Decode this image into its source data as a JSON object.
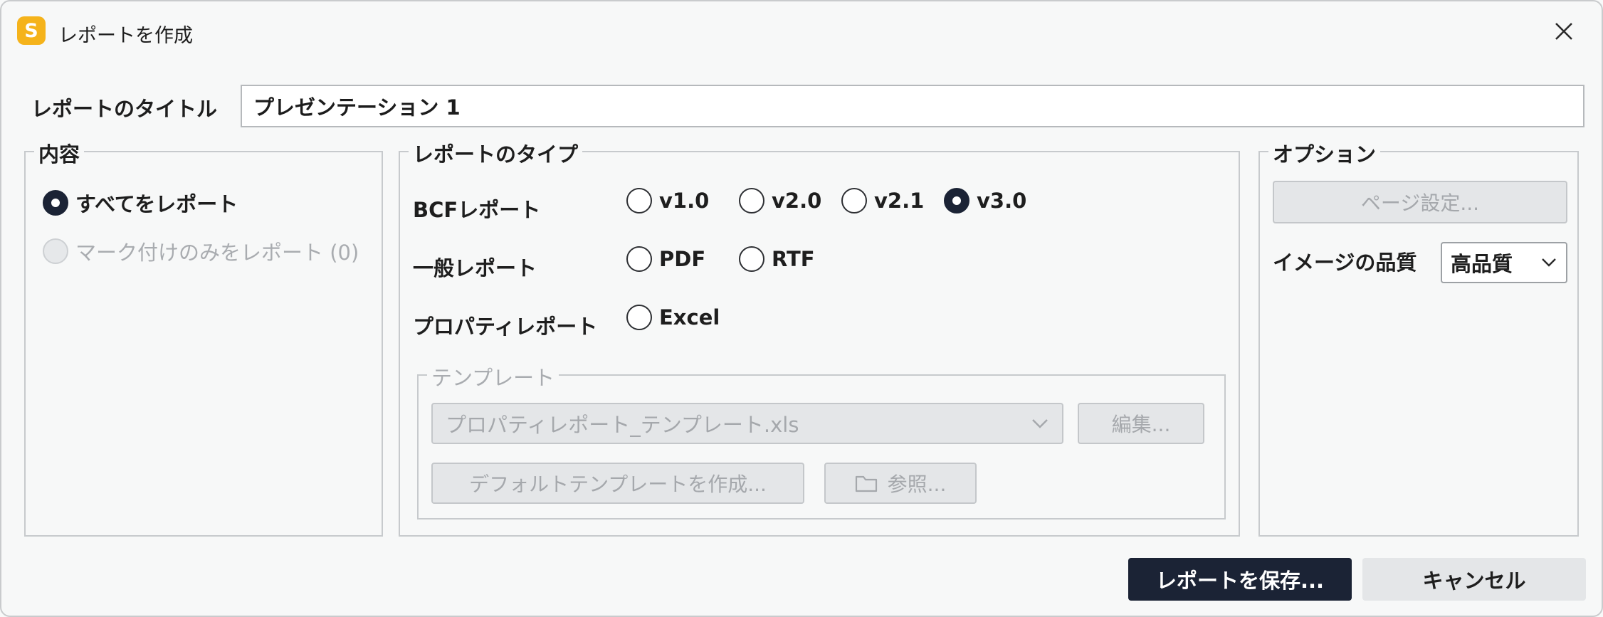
{
  "window": {
    "title": "レポートを作成",
    "app_icon_letter": "S",
    "app_icon_color": "#f5b31b"
  },
  "report_title": {
    "label": "レポートのタイトル",
    "value": "プレゼンテーション 1"
  },
  "content_group": {
    "legend": "内容",
    "options": [
      {
        "label": "すべてをレポート",
        "checked": true,
        "disabled": false
      },
      {
        "label": "マーク付けのみをレポート (0)",
        "checked": false,
        "disabled": true
      }
    ]
  },
  "type_group": {
    "legend": "レポートのタイプ",
    "bcf": {
      "label": "BCFレポート",
      "options": [
        {
          "label": "v1.0",
          "checked": false
        },
        {
          "label": "v2.0",
          "checked": false
        },
        {
          "label": "v2.1",
          "checked": false
        },
        {
          "label": "v3.0",
          "checked": true
        }
      ]
    },
    "general": {
      "label": "一般レポート",
      "options": [
        {
          "label": "PDF",
          "checked": false
        },
        {
          "label": "RTF",
          "checked": false
        }
      ]
    },
    "property": {
      "label": "プロパティレポート",
      "options": [
        {
          "label": "Excel",
          "checked": false
        }
      ]
    },
    "template": {
      "legend": "テンプレート",
      "selected": "プロパティレポート_テンプレート.xls",
      "edit_button": "編集...",
      "create_default_button": "デフォルトテンプレートを作成...",
      "browse_button": "参照..."
    }
  },
  "options_group": {
    "legend": "オプション",
    "page_setup_button": "ページ設定...",
    "image_quality_label": "イメージの品質",
    "image_quality_value": "高品質"
  },
  "footer": {
    "save_button": "レポートを保存...",
    "cancel_button": "キャンセル"
  },
  "colors": {
    "primary": "#1b2335",
    "window_bg": "#f7f8f8",
    "disabled_text": "#a9acb0"
  }
}
